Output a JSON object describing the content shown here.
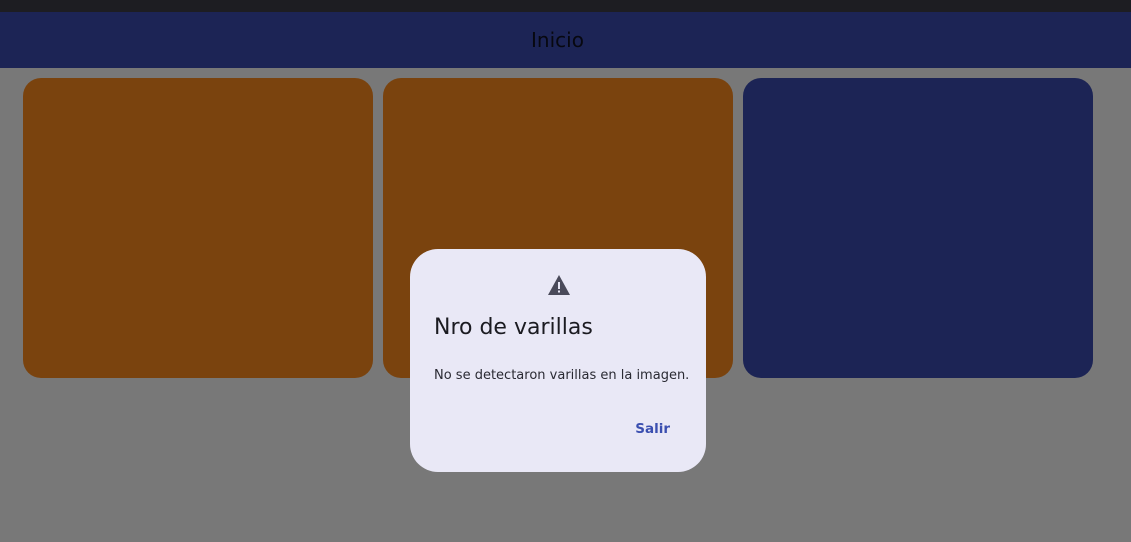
{
  "app_bar": {
    "title": "Inicio",
    "color": "#3949ab"
  },
  "cards": [
    {
      "name": "card-1",
      "color": "#f5861c"
    },
    {
      "name": "card-2",
      "color": "#f5861c"
    },
    {
      "name": "card-3",
      "color": "#3949ab"
    }
  ],
  "dialog": {
    "icon": "warning-icon",
    "title": "Nro de varillas",
    "body": "No se detectaron varillas en la imagen.",
    "action_label": "Salir",
    "accent": "#3b4fb0",
    "background": "#e9e8f6"
  }
}
